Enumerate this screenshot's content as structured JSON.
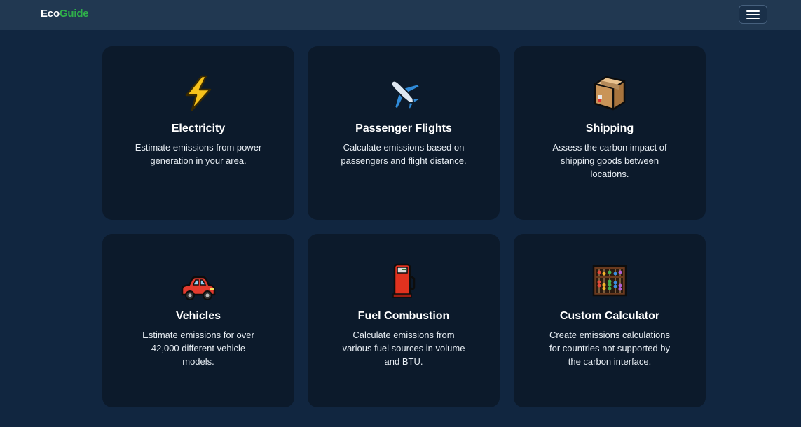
{
  "navbar": {
    "brand_first": "Eco",
    "brand_second": "Guide",
    "menu_icon": "hamburger-menu-icon"
  },
  "colors": {
    "background": "#112640",
    "navbar": "#213851",
    "card": "#0c1a2b",
    "brand_accent": "#2fb04a"
  },
  "cards": [
    {
      "icon": "lightning-bolt-icon",
      "title": "Electricity",
      "desc_lines": [
        "Estimate emissions from power",
        "generation in your area."
      ]
    },
    {
      "icon": "airplane-icon",
      "title": "Passenger Flights",
      "desc_lines": [
        "Calculate emissions based on",
        "passengers and flight distance."
      ]
    },
    {
      "icon": "package-box-icon",
      "title": "Shipping",
      "desc_lines": [
        "Assess the carbon impact of",
        "shipping goods between",
        "locations."
      ]
    },
    {
      "icon": "car-icon",
      "title": "Vehicles",
      "desc_lines": [
        "Estimate emissions for over",
        "42,000 different vehicle",
        "models."
      ]
    },
    {
      "icon": "fuel-pump-icon",
      "title": "Fuel Combustion",
      "desc_lines": [
        "Calculate emissions from",
        "various fuel sources in volume",
        "and BTU."
      ]
    },
    {
      "icon": "abacus-icon",
      "title": "Custom Calculator",
      "desc_lines": [
        "Create emissions calculations",
        "for countries not supported by",
        "the carbon interface."
      ]
    }
  ]
}
